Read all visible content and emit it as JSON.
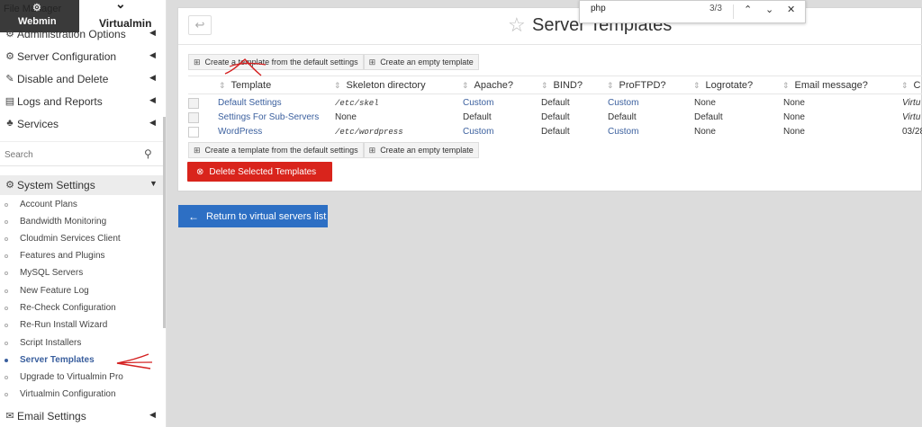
{
  "sidebar": {
    "tabs": {
      "webmin": "Webmin",
      "virtualmin": "Virtualmin",
      "ghost_text": "File Manager"
    },
    "menu": [
      {
        "label": "Administration Options",
        "icon": "gear-icon"
      },
      {
        "label": "Server Configuration",
        "icon": "gears-icon"
      },
      {
        "label": "Disable and Delete",
        "icon": "plug-icon"
      },
      {
        "label": "Logs and Reports",
        "icon": "document-icon"
      },
      {
        "label": "Services",
        "icon": "sitemap-icon"
      }
    ],
    "search_placeholder": "Search",
    "system_settings": {
      "label": "System Settings",
      "icon": "gear-icon"
    },
    "sub_items": [
      "Account Plans",
      "Bandwidth Monitoring",
      "Cloudmin Services Client",
      "Features and Plugins",
      "MySQL Servers",
      "New Feature Log",
      "Re-Check Configuration",
      "Re-Run Install Wizard",
      "Script Installers",
      "Server Templates",
      "Upgrade to Virtualmin Pro",
      "Virtualmin Configuration"
    ],
    "active_sub_item": "Server Templates",
    "email_settings": {
      "label": "Email Settings",
      "icon": "envelope-icon"
    }
  },
  "page": {
    "title": "Server Templates",
    "back_icon": "back-arrow-icon",
    "favorite_icon": "star-icon"
  },
  "toolbar": {
    "create_from_default": "Create a template from the default settings",
    "create_empty": "Create an empty template"
  },
  "table": {
    "columns": [
      "Template",
      "Skeleton directory",
      "Apache?",
      "BIND?",
      "ProFTPD?",
      "Logrotate?",
      "Email message?",
      "C"
    ],
    "rows": [
      {
        "template": "Default Settings",
        "skeleton": "/etc/skel",
        "apache": "Custom",
        "bind": "Default",
        "proftpd": "Custom",
        "logrotate": "None",
        "email": "None",
        "extra": "Virtu"
      },
      {
        "template": "Settings For Sub-Servers",
        "skeleton": "None",
        "apache": "Default",
        "bind": "Default",
        "proftpd": "Default",
        "logrotate": "Default",
        "email": "None",
        "extra": "Virtu"
      },
      {
        "template": "WordPress",
        "skeleton": "/etc/wordpress",
        "apache": "Custom",
        "bind": "Default",
        "proftpd": "Custom",
        "logrotate": "None",
        "email": "None",
        "extra": "03/28"
      }
    ]
  },
  "actions": {
    "delete_selected": "Delete Selected Templates",
    "return_to_list": "Return to virtual servers list"
  },
  "findbar": {
    "query": "php",
    "count": "3/3"
  },
  "colors": {
    "link": "#3a5f9e",
    "delete_button": "#d9241c",
    "return_button": "#2d6fc4",
    "annotation": "#d42020"
  }
}
